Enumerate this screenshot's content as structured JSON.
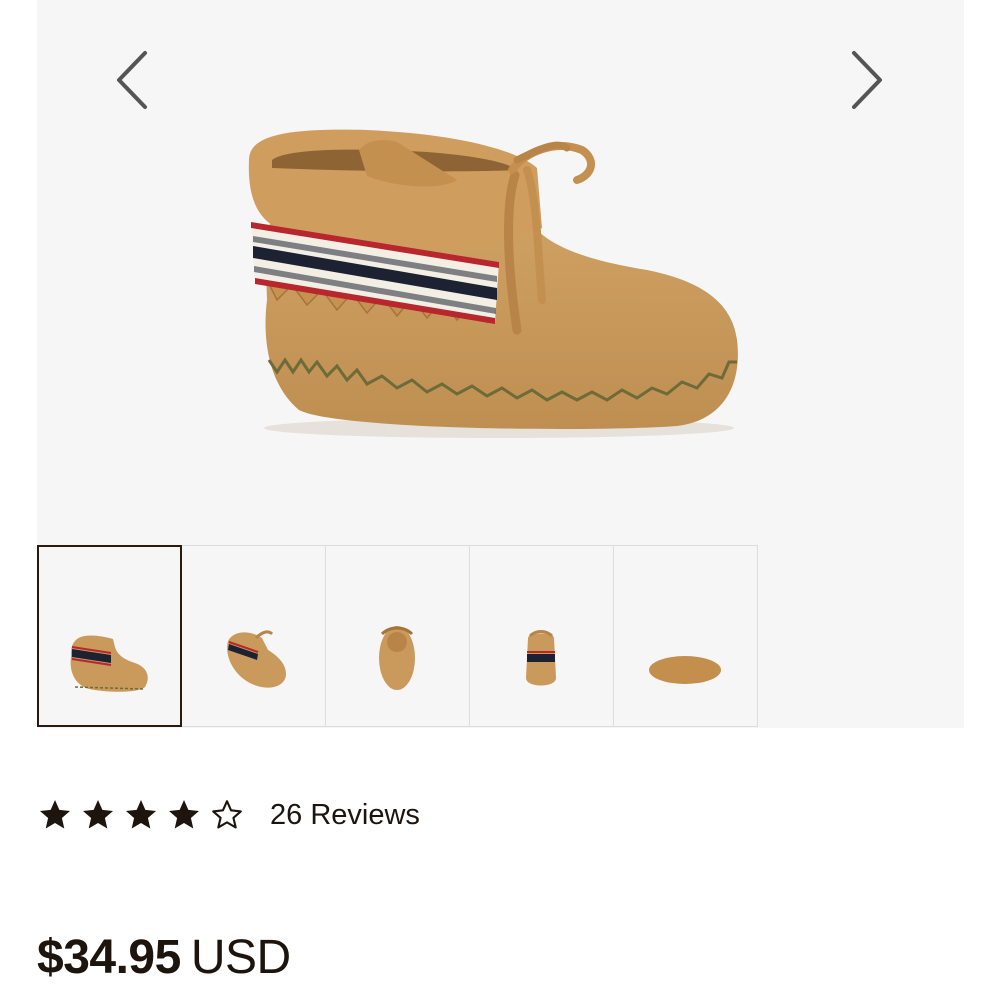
{
  "gallery": {
    "prev_icon": "chevron-left-icon",
    "next_icon": "chevron-right-icon",
    "selected_thumbnail": 1,
    "thumbnails": [
      {
        "view": "side"
      },
      {
        "view": "angled"
      },
      {
        "view": "top"
      },
      {
        "view": "back"
      },
      {
        "view": "sole"
      }
    ]
  },
  "rating": {
    "value": 4,
    "max": 5,
    "reviews_label": "26 Reviews"
  },
  "price": {
    "amount": "$34.95",
    "currency": "USD"
  },
  "colors": {
    "suede": "#c99a5b",
    "text": "#1c140d",
    "accent_red": "#b8262e",
    "accent_navy": "#1d2233"
  }
}
